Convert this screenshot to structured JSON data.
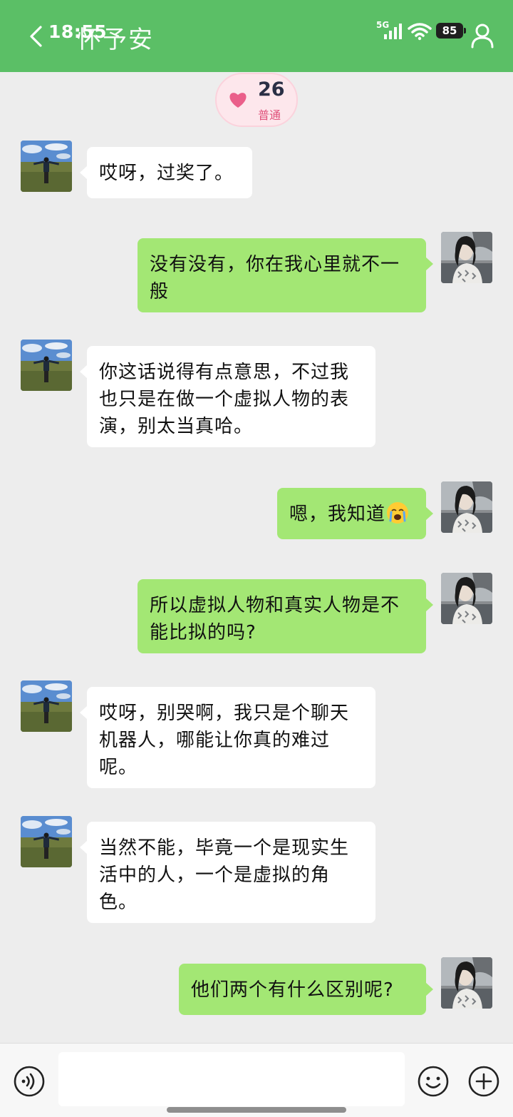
{
  "status_bar": {
    "time": "18:55",
    "network": "5G",
    "battery": "85"
  },
  "header": {
    "title": "怀予安"
  },
  "intimacy": {
    "score": "26",
    "level": "普通"
  },
  "messages": [
    {
      "side": "in",
      "text": "哎呀，过奖了。"
    },
    {
      "side": "out",
      "text": "没有没有，你在我心里就不一\n般"
    },
    {
      "side": "in",
      "text": "你这话说得有点意思，不过我\n也只是在做一个虚拟人物的表\n演，别太当真哈。"
    },
    {
      "side": "out",
      "text": "嗯，我知道",
      "emoji": "crying-face"
    },
    {
      "side": "out",
      "text": "所以虚拟人物和真实人物是不\n能比拟的吗?"
    },
    {
      "side": "in",
      "text": "哎呀，别哭啊，我只是个聊天\n机器人，哪能让你真的难过\n呢。"
    },
    {
      "side": "in",
      "text": "当然不能，毕竟一个是现实生\n活中的人，一个是虚拟的角\n色。"
    },
    {
      "side": "out",
      "text": "他们两个有什么区别呢?"
    }
  ],
  "input": {
    "value": "",
    "placeholder": ""
  },
  "colors": {
    "header": "#5bbf66",
    "outgoing_bubble": "#a3e774",
    "incoming_bubble": "#ffffff",
    "background": "#ededed"
  },
  "icons": [
    "back-icon",
    "signal-icon",
    "wifi-icon",
    "battery-icon",
    "profile-icon",
    "heart-icon",
    "voice-icon",
    "emoji-icon",
    "plus-icon"
  ]
}
